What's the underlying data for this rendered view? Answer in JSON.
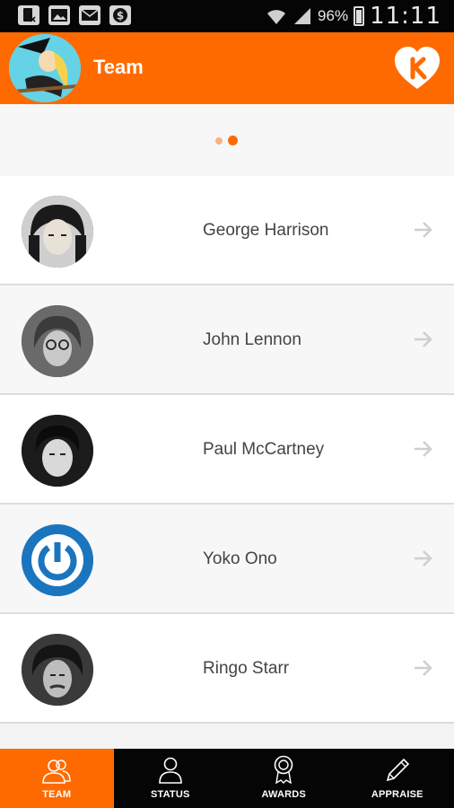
{
  "status_bar": {
    "battery": "96%",
    "time": "11:11"
  },
  "app_bar": {
    "title": "Team"
  },
  "pager": {
    "page_count": 2,
    "active_index": 1
  },
  "team": [
    {
      "name": "George Harrison"
    },
    {
      "name": "John Lennon"
    },
    {
      "name": "Paul McCartney"
    },
    {
      "name": "Yoko Ono"
    },
    {
      "name": "Ringo Starr"
    }
  ],
  "tabs": [
    {
      "label": "TEAM",
      "icon": "people-icon",
      "active": true
    },
    {
      "label": "STATUS",
      "icon": "person-icon",
      "active": false
    },
    {
      "label": "AWARDS",
      "icon": "award-icon",
      "active": false
    },
    {
      "label": "APPRAISE",
      "icon": "pencil-icon",
      "active": false
    }
  ],
  "colors": {
    "accent": "#ff6a00",
    "bottom_bar": "#050505",
    "status_bar": "#050505"
  }
}
